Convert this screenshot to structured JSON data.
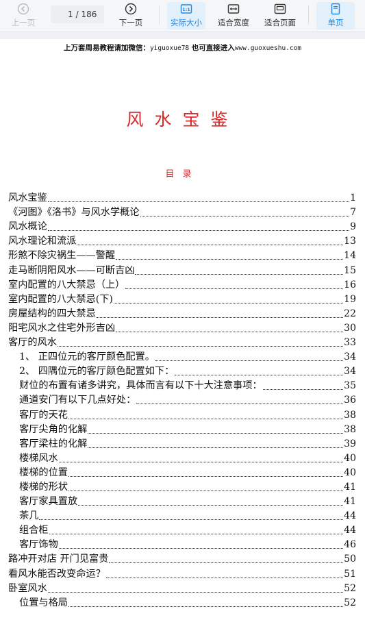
{
  "toolbar": {
    "prev_label": "上一页",
    "page_current": "1",
    "page_total": "/ 186",
    "next_label": "下一页",
    "actual_size_label": "实际大小",
    "actual_size_icon_text": "1:1",
    "fit_width_label": "适合宽度",
    "fit_page_label": "适合页面",
    "single_page_label": "单页"
  },
  "document": {
    "notice_prefix": "上万套周易教程请加微信：",
    "notice_wechat": "yiguoxue78",
    "notice_mid": "  也可直接进入",
    "notice_site": "www.guoxueshu.com",
    "title": "风水宝鉴",
    "toc_heading": "目录",
    "toc": [
      {
        "text": "风水宝鉴",
        "page": "1"
      },
      {
        "text": "《河图》《洛书》与风水学概论",
        "page": "7"
      },
      {
        "text": "风水概论",
        "page": "9"
      },
      {
        "text": "风水理论和流派",
        "page": "13"
      },
      {
        "text": "形煞不除灾祸生——警醒",
        "page": "14"
      },
      {
        "text": "走马断阴阳风水——可断吉凶",
        "page": "15"
      },
      {
        "text": "室内配置的八大禁忌（上）",
        "page": "16"
      },
      {
        "text": "室内配置的八大禁忌(下)",
        "page": "19"
      },
      {
        "text": "房屋结构的四大禁忌",
        "page": "22"
      },
      {
        "text": "阳宅风水之住宅外形吉凶",
        "page": "30"
      },
      {
        "text": "客厅的风水",
        "page": "33"
      },
      {
        "text": "1、 正四位元的客厅颜色配置。",
        "page": "34"
      },
      {
        "text": "2、 四隅位元的客厅颜色配置如下：",
        "page": "34"
      },
      {
        "text": "财位的布置有诸多讲究，具体而言有以下十大注意事项：",
        "page": "35"
      },
      {
        "text": "通道安门有以下几点好处：",
        "page": "36"
      },
      {
        "text": "客厅的天花",
        "page": "38"
      },
      {
        "text": "客厅尖角的化解",
        "page": "38"
      },
      {
        "text": "客厅梁柱的化解",
        "page": "39"
      },
      {
        "text": "楼梯风水",
        "page": "40"
      },
      {
        "text": "楼梯的位置",
        "page": "40"
      },
      {
        "text": "楼梯的形状",
        "page": "41"
      },
      {
        "text": "客厅家具置放",
        "page": "41"
      },
      {
        "text": "茶几",
        "page": "44"
      },
      {
        "text": "组合柜",
        "page": "44"
      },
      {
        "text": "客厅饰物",
        "page": "46"
      },
      {
        "text": "路冲开对店 开门见富贵",
        "page": "50"
      },
      {
        "text": "看风水能否改变命运？",
        "page": "51"
      },
      {
        "text": "卧室风水",
        "page": "52"
      },
      {
        "text": "位置与格局",
        "page": "52"
      }
    ]
  },
  "colors": {
    "accent": "#1e88e5",
    "title_red": "#d7282a"
  }
}
